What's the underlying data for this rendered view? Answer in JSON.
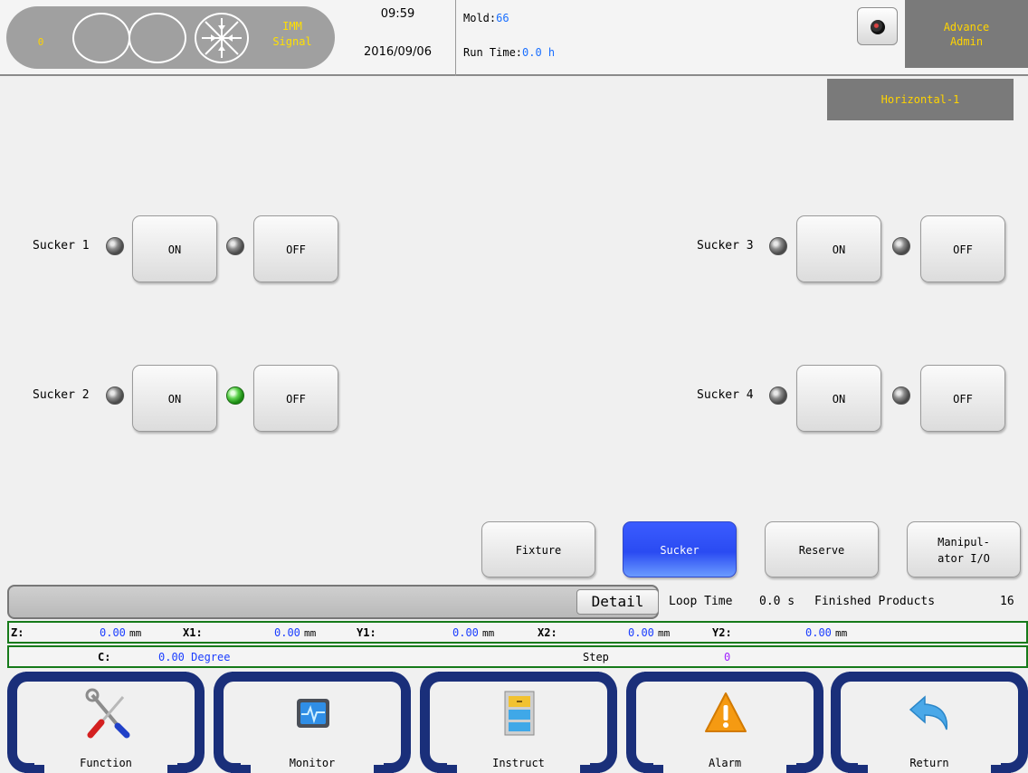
{
  "status": {
    "count": "0",
    "signal_line1": "IMM",
    "signal_line2": "Signal"
  },
  "clock": {
    "time": "09:59",
    "date": "2016/09/06"
  },
  "mold": {
    "label": "Mold:",
    "value": "66"
  },
  "run_time": {
    "label": "Run Time:",
    "value": "0.0 h"
  },
  "user": {
    "line1": "Advance",
    "line2": "Admin"
  },
  "mode": "Horizontal-1",
  "suckers": [
    {
      "label": "Sucker 1",
      "on_label": "ON",
      "off_label": "OFF",
      "on_led": "off",
      "off_led": "off"
    },
    {
      "label": "Sucker 2",
      "on_label": "ON",
      "off_label": "OFF",
      "on_led": "off",
      "off_led": "on"
    },
    {
      "label": "Sucker 3",
      "on_label": "ON",
      "off_label": "OFF",
      "on_led": "off",
      "off_led": "off"
    },
    {
      "label": "Sucker 4",
      "on_label": "ON",
      "off_label": "OFF",
      "on_led": "off",
      "off_led": "off"
    }
  ],
  "tabs": [
    {
      "label": "Fixture",
      "active": false
    },
    {
      "label": "Sucker",
      "active": true
    },
    {
      "label": "Reserve",
      "active": false
    },
    {
      "label_line1": "Manipul-",
      "label_line2": "ator I/O",
      "active": false
    }
  ],
  "info": {
    "detail_label": "Detail",
    "loop_time_label": "Loop Time",
    "loop_time_value": "0.0 s",
    "finished_label": "Finished Products",
    "finished_value": "16"
  },
  "axes": {
    "z": {
      "label": "Z:",
      "value": "0.00",
      "unit": "mm"
    },
    "x1": {
      "label": "X1:",
      "value": "0.00",
      "unit": "mm"
    },
    "y1": {
      "label": "Y1:",
      "value": "0.00",
      "unit": "mm"
    },
    "x2": {
      "label": "X2:",
      "value": "0.00",
      "unit": "mm"
    },
    "y2": {
      "label": "Y2:",
      "value": "0.00",
      "unit": "mm"
    },
    "c": {
      "label": "C:",
      "value": "0.00 Degree"
    },
    "step": {
      "label": "Step",
      "value": "0"
    }
  },
  "nav": [
    {
      "label": "Function",
      "icon": "wrench-screwdriver-icon"
    },
    {
      "label": "Monitor",
      "icon": "monitor-icon"
    },
    {
      "label": "Instruct",
      "icon": "file-cabinet-icon"
    },
    {
      "label": "Alarm",
      "icon": "warning-icon"
    },
    {
      "label": "Return",
      "icon": "return-arrow-icon"
    }
  ],
  "colors": {
    "accent_blue": "#2a4bf2",
    "nav_bracket": "#1a2f7a",
    "axis_border": "#167a1a",
    "signal_yellow": "#ffd400",
    "led_green": "#5fd24f"
  }
}
